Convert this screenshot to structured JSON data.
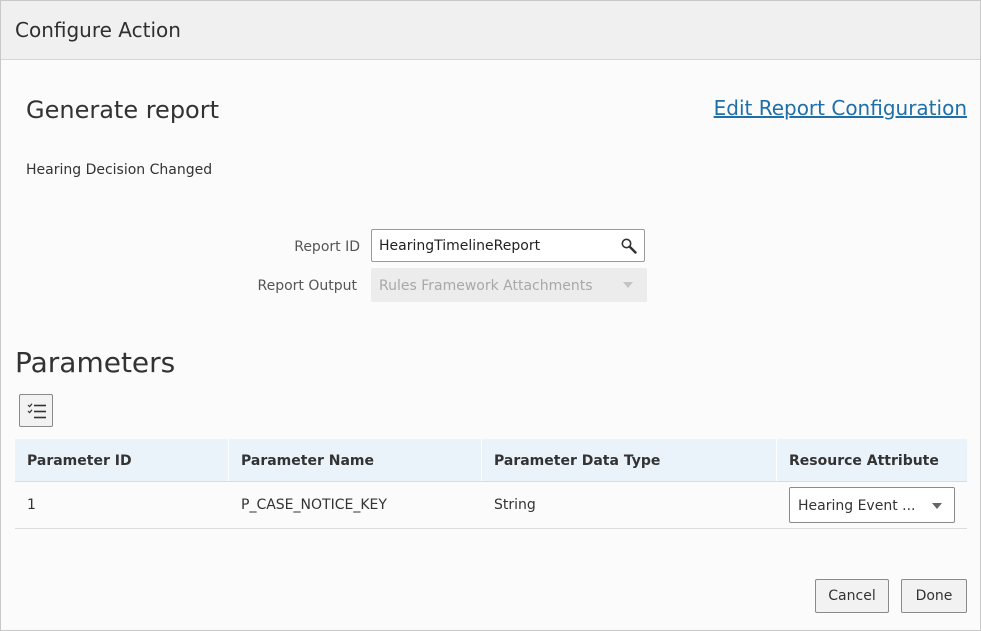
{
  "dialog": {
    "title": "Configure Action"
  },
  "action": {
    "heading": "Generate report",
    "edit_link": "Edit Report Configuration",
    "event_name": "Hearing Decision Changed"
  },
  "form": {
    "report_id_label": "Report ID",
    "report_id_value": "HearingTimelineReport",
    "report_output_label": "Report Output",
    "report_output_value": "Rules Framework Attachments"
  },
  "parameters": {
    "heading": "Parameters",
    "columns": [
      "Parameter ID",
      "Parameter Name",
      "Parameter Data Type",
      "Resource Attribute"
    ],
    "rows": [
      {
        "id": "1",
        "name": "P_CASE_NOTICE_KEY",
        "data_type": "String",
        "resource_attribute": "Hearing Event  ..."
      }
    ]
  },
  "buttons": {
    "cancel": "Cancel",
    "done": "Done"
  },
  "icons": {
    "search": "search-icon",
    "list": "checklist-icon",
    "caret": "chevron-down-icon"
  },
  "colors": {
    "link": "#1f6fa8",
    "table_header": "#eaf2fa",
    "titlebar": "#f0f0f0"
  }
}
